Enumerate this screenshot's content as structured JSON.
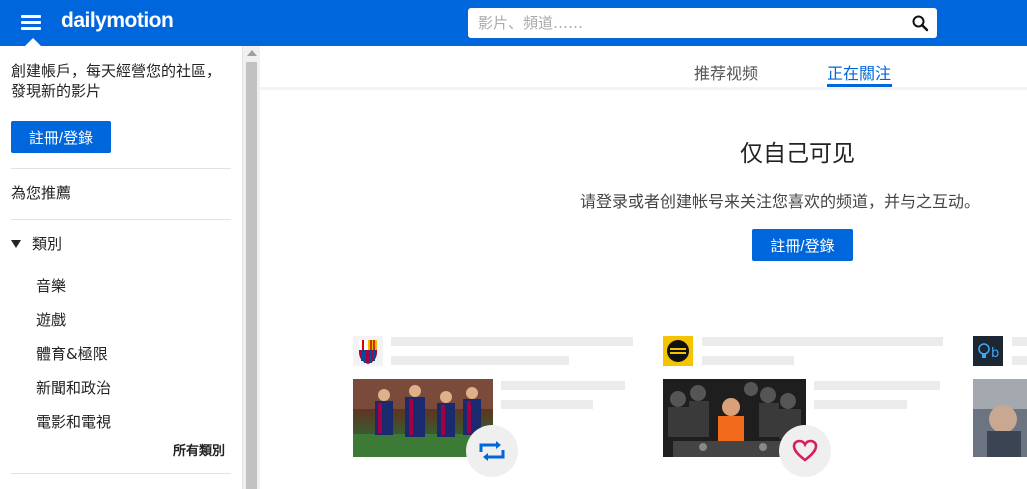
{
  "header": {
    "logo_text": "dailymotion",
    "search_placeholder": "影片、頻道……",
    "brand_color": "#0066dc"
  },
  "sidebar": {
    "promo_text": "創建帳戶，每天經營您的社區，發現新的影片",
    "signup_label": "註冊/登錄",
    "recommended_label": "為您推薦",
    "categories_label": "類別",
    "categories": [
      "音樂",
      "遊戲",
      "體育&極限",
      "新聞和政治",
      "電影和電視"
    ],
    "all_categories_label": "所有類別"
  },
  "main": {
    "tabs": [
      {
        "label": "推荐视频",
        "active": false
      },
      {
        "label": "正在關注",
        "active": true
      }
    ],
    "private_title": "仅自己可见",
    "private_desc": "请登录或者创建帐号来关注您喜欢的频道，并与之互动。",
    "signup_label": "註冊/登錄"
  },
  "icons": {
    "menu": "hamburger-menu-icon",
    "search": "search-icon",
    "repost": "repost-icon",
    "like": "heart-icon"
  }
}
